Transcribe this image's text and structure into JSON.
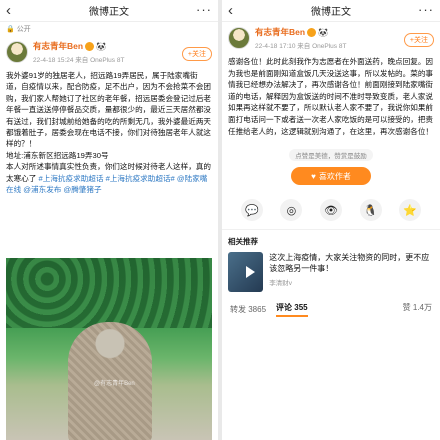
{
  "left": {
    "topbar": {
      "back": "‹",
      "title": "微博正文",
      "more": "···"
    },
    "public_label": "公开",
    "author": {
      "name": "有志青年Ben",
      "time": "22-4-18 15:24",
      "from": "来自 OnePlus 8T",
      "follow": "+关注"
    },
    "text": "我外婆91岁的独居老人，招远路19弄居民，属于陆家嘴街道，自疫情以来，配合防疫，足不出户，因为不会抢菜不会团购，我们家人帮她订了社区的老年餐，招远居委会登记过后老年餐一直送送停停餐品交质，量都很少的，最近三天居然都没有送过，我们封城前给她备的吃的所剩无几，我外婆最近两天都饿着肚子，居委会现在电话不接，你们对待独居老年人就这样的？！",
    "address": "地址:浦东新区招远路19弄30号",
    "text2": "本人对所述事情真实性负责，你们这时候对待老人这样，真的太寒心了",
    "tags": "#上海抗疫求助超话 #上海抗疫求助超话# @陆家嘴在线 @浦东发布 @腾肇猪子",
    "photo_watermark": "@有志青年Ben"
  },
  "right": {
    "topbar": {
      "back": "‹",
      "title": "微博正文",
      "more": "···"
    },
    "author": {
      "name": "有志青年Ben",
      "time": "22-4-18 17:10",
      "from": "来自 OnePlus 8T",
      "follow": "+关注"
    },
    "text": "感谢各位！此时此刻我作为志愿者在外面送药，晚点回复。因为我也是前面刚知道盒饭几天没送这事，所以发帖的。菜的事情我已经想办法解决了，再次感谢各位！前面刚接到陆家嘴街道的电话，解释因为盒饭送的时间不准时导致变质，老人家说如果再这样就不要了，所以默认老人家不要了，我说你如果前面打电话问一下或者送一次老人家吃饭的是可以接受的，把责任推给老人的，这逻辑就别沟通了，在这里，再次感谢各位！",
    "reward_hint": "点赞是美德，赞赏是鼓励",
    "reward_button": "喜欢作者",
    "section_label": "相关推荐",
    "related": {
      "title": "这次上海疫情，大家关注物资的同时，更不应该忽略另一件事！",
      "source": "李清财v"
    },
    "stats": {
      "repost_label": "转发",
      "repost_count": "3865",
      "comment_label": "评论",
      "comment_count": "355",
      "like_label": "赞",
      "like_count": "1.4万"
    }
  }
}
